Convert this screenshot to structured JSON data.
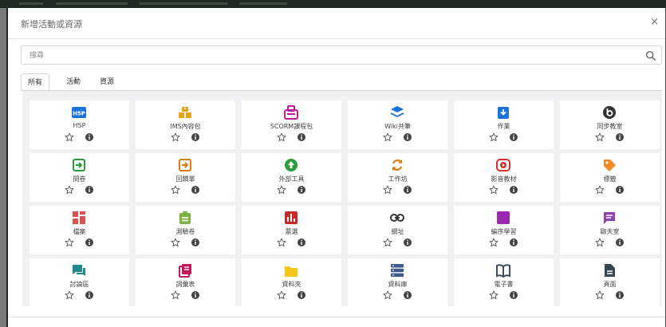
{
  "modal": {
    "title": "新增活動或資源",
    "close_glyph": "×"
  },
  "search": {
    "placeholder": "搜尋"
  },
  "tabs": [
    {
      "label": "所有",
      "active": true
    },
    {
      "label": "活動",
      "active": false
    },
    {
      "label": "資源",
      "active": false
    }
  ],
  "items": [
    {
      "label": "H5P",
      "icon": "h5p-icon",
      "color": "#1a73d9"
    },
    {
      "label": "IMS內容包",
      "icon": "ims-package-icon",
      "color": "#e8a317"
    },
    {
      "label": "SCORM課程包",
      "icon": "scorm-package-icon",
      "color": "#c2189b"
    },
    {
      "label": "Wiki共筆",
      "icon": "wiki-icon",
      "color": "#1a73d9"
    },
    {
      "label": "作業",
      "icon": "assignment-icon",
      "color": "#1a73d9"
    },
    {
      "label": "同步教室",
      "icon": "bigbluebutton-icon",
      "color": "#333333"
    },
    {
      "label": "問卷",
      "icon": "questionnaire-icon",
      "color": "#2a9d3a"
    },
    {
      "label": "回饋單",
      "icon": "feedback-icon",
      "color": "#e07b17"
    },
    {
      "label": "外部工具",
      "icon": "external-tool-icon",
      "color": "#2a9d3a"
    },
    {
      "label": "工作坊",
      "icon": "workshop-icon",
      "color": "#e07b17"
    },
    {
      "label": "影音教材",
      "icon": "video-icon",
      "color": "#d22f2f"
    },
    {
      "label": "標籤",
      "icon": "label-icon",
      "color": "#f08a24"
    },
    {
      "label": "檔案",
      "icon": "file-icon",
      "color": "#d9534f"
    },
    {
      "label": "測驗卷",
      "icon": "quiz-icon",
      "color": "#7cb342"
    },
    {
      "label": "票選",
      "icon": "choice-icon",
      "color": "#c62828"
    },
    {
      "label": "網址",
      "icon": "url-icon",
      "color": "#333333"
    },
    {
      "label": "編序學習",
      "icon": "lesson-icon",
      "color": "#9c27b0"
    },
    {
      "label": "聊天室",
      "icon": "chat-icon",
      "color": "#8e44ad"
    },
    {
      "label": "討論區",
      "icon": "forum-icon",
      "color": "#1e8a8a"
    },
    {
      "label": "詞彙表",
      "icon": "glossary-icon",
      "color": "#c2185b"
    },
    {
      "label": "資料夾",
      "icon": "folder-icon",
      "color": "#f5c518"
    },
    {
      "label": "資料庫",
      "icon": "database-icon",
      "color": "#3d5a8a"
    },
    {
      "label": "電子書",
      "icon": "book-icon",
      "color": "#3d4a5c"
    },
    {
      "label": "頁面",
      "icon": "page-icon",
      "color": "#37474f"
    }
  ]
}
